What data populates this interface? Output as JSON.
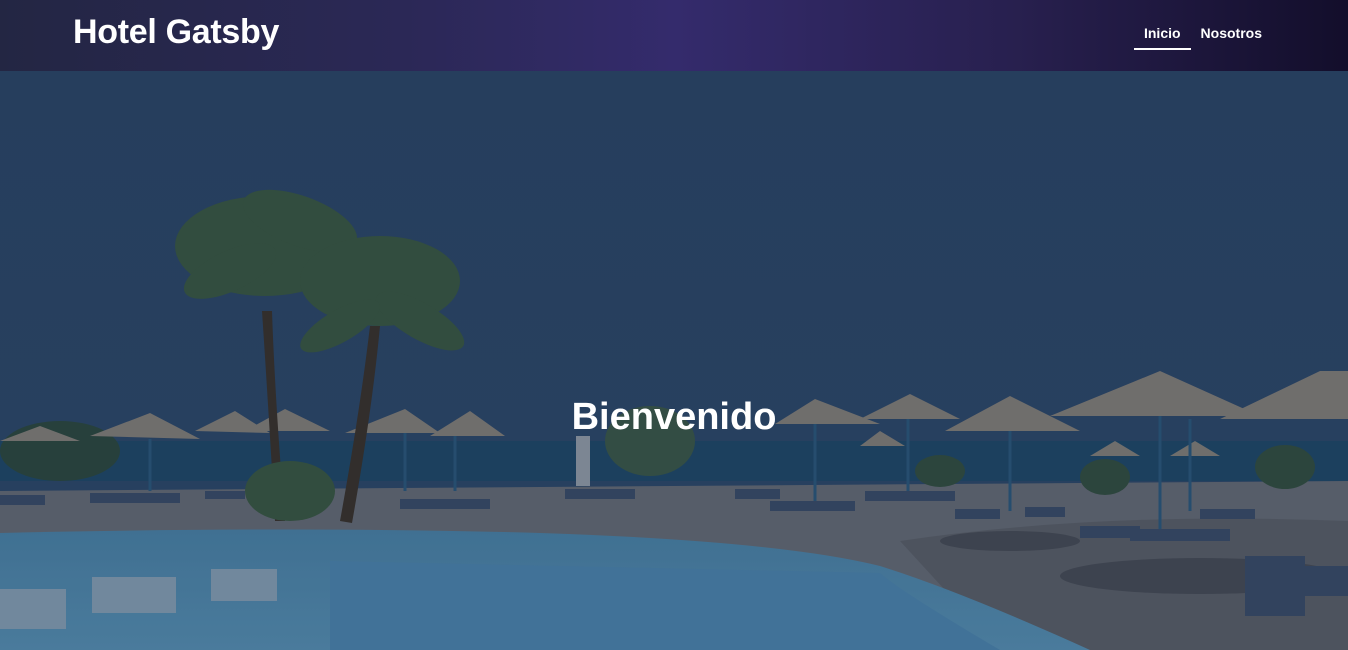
{
  "header": {
    "site_title": "Hotel Gatsby",
    "nav": [
      {
        "label": "Inicio",
        "active": true
      },
      {
        "label": "Nosotros",
        "active": false
      }
    ]
  },
  "hero": {
    "title": "Bienvenido",
    "background_image": "resort-pool-beach-palm-trees"
  },
  "colors": {
    "header_start": "#232643",
    "header_mid": "#342b6c",
    "header_end": "#130e2b",
    "sky": "#2c4662",
    "text": "#ffffff"
  }
}
